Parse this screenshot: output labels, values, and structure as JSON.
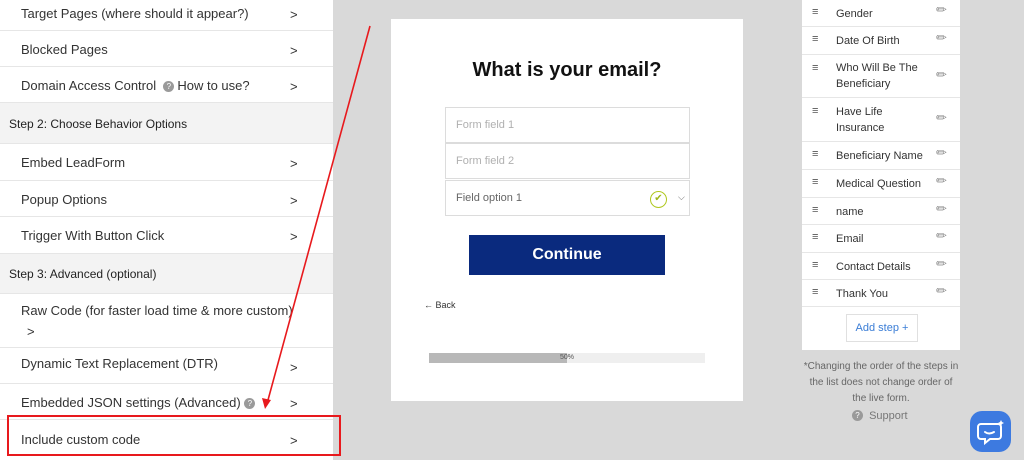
{
  "left_panel": {
    "rows_top": [
      {
        "label": "Target Pages (where should it appear?)"
      },
      {
        "label": "Blocked Pages"
      }
    ],
    "domain_access": {
      "label": "Domain Access Control",
      "help": "How to use?"
    },
    "step2_header": "Step 2: Choose Behavior Options",
    "step2_rows": [
      {
        "label": "Embed LeadForm"
      },
      {
        "label": "Popup Options"
      },
      {
        "label": "Trigger With Button Click"
      }
    ],
    "step3_header": "Step 3: Advanced (optional)",
    "raw_code": "Raw Code (for faster load time & more custom)",
    "dtr": "Dynamic Text Replacement (DTR)",
    "json_settings": "Embedded JSON settings (Advanced)",
    "custom_code": "Include custom code",
    "chevron": ">"
  },
  "preview": {
    "title": "What is your email?",
    "field1_placeholder": "Form field 1",
    "field2_placeholder": "Form field 2",
    "select_value": "Field option 1",
    "continue_label": "Continue",
    "back_label": "← Back",
    "progress_text": "50%",
    "progress_fraction": 0.5
  },
  "steps_panel": {
    "items": [
      {
        "name": "Gender"
      },
      {
        "name": "Date Of Birth"
      },
      {
        "name": "Who Will Be The Beneficiary"
      },
      {
        "name": "Have Life Insurance"
      },
      {
        "name": "Beneficiary Name"
      },
      {
        "name": "Medical Question"
      },
      {
        "name": "name"
      },
      {
        "name": "Email"
      },
      {
        "name": "Contact Details"
      },
      {
        "name": "Thank You"
      }
    ],
    "add_step_label": "Add step +",
    "note": "*Changing the order of the steps in the list does not change order of the live form.",
    "support_label": "Support"
  },
  "colors": {
    "highlight": "#e8191d",
    "continue_button": "#0a2a7e",
    "link": "#3a7dd6",
    "chat_bubble": "#3d7ae0"
  },
  "icons": [
    "chevron-right-icon",
    "help-circle-icon",
    "check-circle-icon",
    "chevron-down-icon",
    "drag-handle-icon",
    "pencil-icon",
    "help-circle-icon",
    "chat-icon"
  ]
}
